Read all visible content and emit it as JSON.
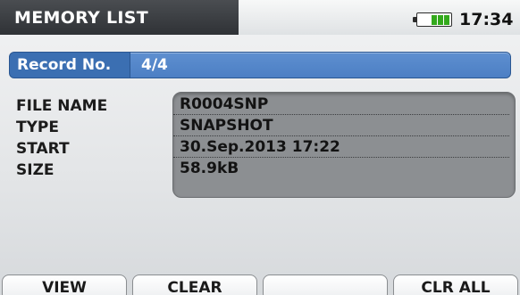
{
  "header": {
    "title": "MEMORY LIST",
    "time": "17:34",
    "battery_level": 0.55,
    "battery_color": "#33a91c"
  },
  "record": {
    "label": "Record No.",
    "value": "4/4"
  },
  "details": {
    "labels": [
      "FILE NAME",
      "TYPE",
      "START",
      "SIZE"
    ],
    "values": [
      "R0004SNP",
      "SNAPSHOT",
      "30.Sep.2013 17:22",
      "58.9kB"
    ]
  },
  "buttons": [
    "VIEW",
    "CLEAR",
    "",
    "CLR ALL"
  ],
  "colors": {
    "title_bar": "#3a3d41",
    "record_blue": "#4c7fc4",
    "info_box": "#8c8f92"
  }
}
